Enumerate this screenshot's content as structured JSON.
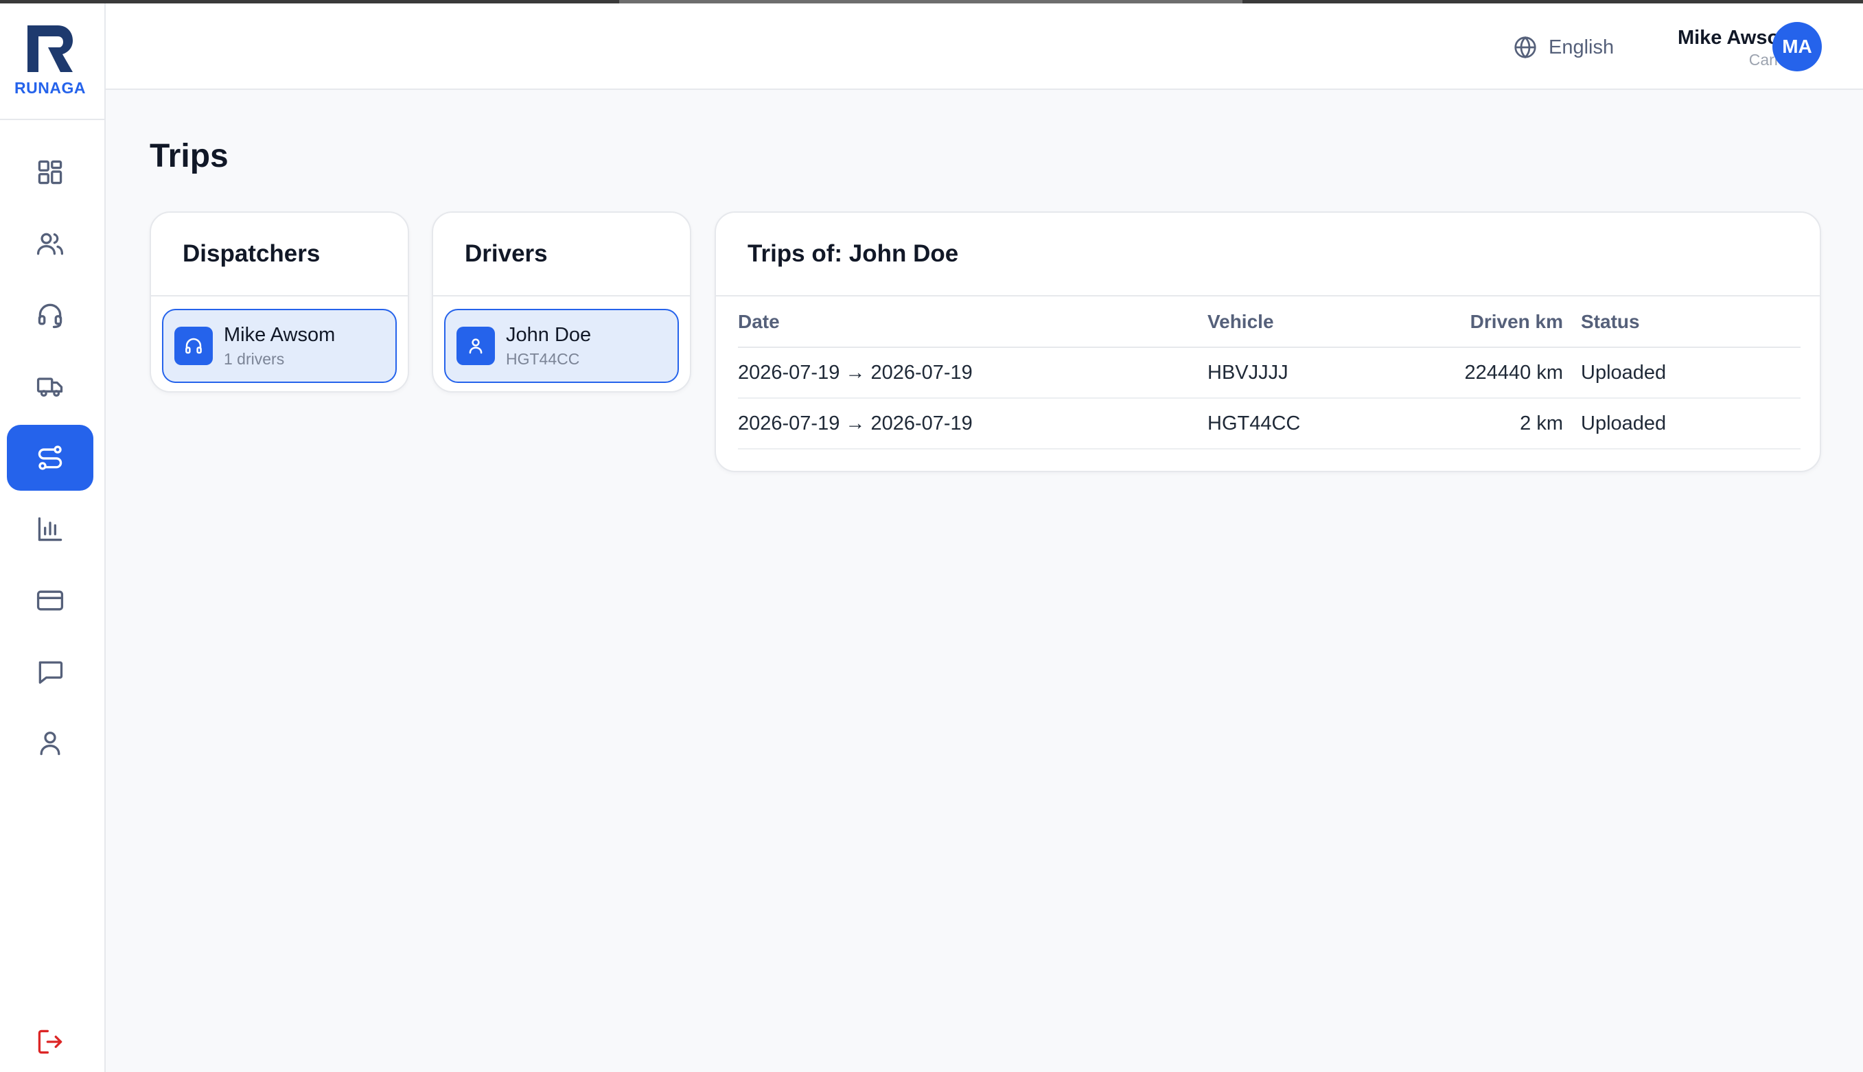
{
  "app": {
    "logo_text": "RUNAGA",
    "accent_color": "#2563eb",
    "danger_color": "#dc2626"
  },
  "sidebar": {
    "items": [
      {
        "icon": "dashboard-grid-icon",
        "active": false
      },
      {
        "icon": "users-icon",
        "active": false
      },
      {
        "icon": "headset-icon",
        "active": false
      },
      {
        "icon": "truck-icon",
        "active": false
      },
      {
        "icon": "route-icon",
        "active": true
      },
      {
        "icon": "bar-chart-icon",
        "active": false
      },
      {
        "icon": "credit-card-icon",
        "active": false
      },
      {
        "icon": "chat-icon",
        "active": false
      },
      {
        "icon": "profile-icon",
        "active": false
      }
    ],
    "logout_icon": "logout-icon"
  },
  "header": {
    "language": "English",
    "user_name": "Mike Awsom",
    "user_role": "Carrier",
    "avatar_initials": "MA"
  },
  "page": {
    "title": "Trips"
  },
  "dispatchers": {
    "title": "Dispatchers",
    "items": [
      {
        "name": "Mike Awsom",
        "sub": "1 drivers",
        "icon": "headset-icon",
        "selected": true
      }
    ]
  },
  "drivers": {
    "title": "Drivers",
    "items": [
      {
        "name": "John Doe",
        "sub": "HGT44CC",
        "icon": "user-icon",
        "selected": true
      }
    ]
  },
  "trips": {
    "title": "Trips of: John Doe",
    "columns": {
      "date": "Date",
      "vehicle": "Vehicle",
      "driven_km": "Driven km",
      "status": "Status"
    },
    "rows": [
      {
        "date": "2026-07-19 → 2026-07-19",
        "vehicle": "HBVJJJJ",
        "driven_km": "224440 km",
        "status": "Uploaded"
      },
      {
        "date": "2026-07-19 → 2026-07-19",
        "vehicle": "HGT44CC",
        "driven_km": "2 km",
        "status": "Uploaded"
      }
    ]
  }
}
